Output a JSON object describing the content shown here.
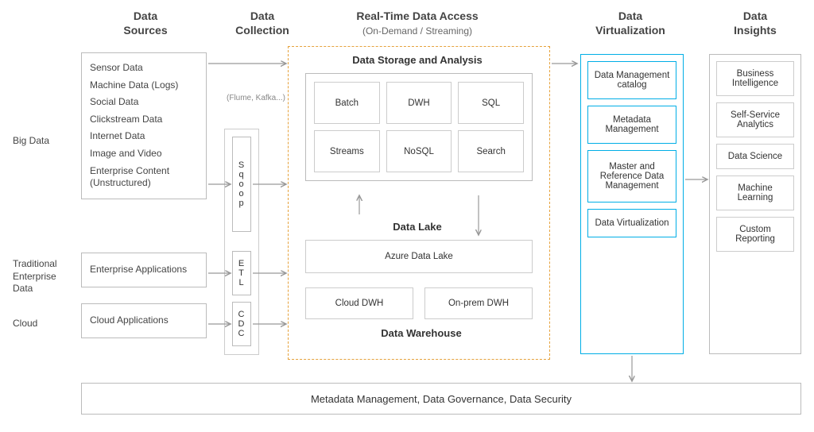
{
  "headers": {
    "sources": "Data\nSources",
    "collection": "Data\nCollection",
    "realtime": "Real-Time Data Access",
    "realtime_sub": "(On-Demand / Streaming)",
    "virtualization": "Data\nVirtualization",
    "insights": "Data\nInsights"
  },
  "row_labels": {
    "bigdata": "Big Data",
    "traditional": "Traditional Enterprise Data",
    "cloud": "Cloud"
  },
  "sources": {
    "bigdata": [
      "Sensor Data",
      "Machine Data (Logs)",
      "Social Data",
      "Clickstream Data",
      "Internet Data",
      "Image and Video",
      "Enterprise Content (Unstructured)"
    ],
    "traditional": "Enterprise Applications",
    "cloud": "Cloud Applications"
  },
  "collection": {
    "note": "(Flume, Kafka...)",
    "sqoop": "S\nq\no\no\np",
    "etl": "E\nT\nL",
    "cdc": "C\nD\nC"
  },
  "storage": {
    "title": "Data Storage and Analysis",
    "cells": [
      "Batch",
      "DWH",
      "SQL",
      "Streams",
      "NoSQL",
      "Search"
    ],
    "lake_title": "Data Lake",
    "lake": "Azure Data Lake",
    "dwh_cells": [
      "Cloud DWH",
      "On-prem DWH"
    ],
    "dw_title": "Data Warehouse"
  },
  "virtualization": [
    "Data Management catalog",
    "Metadata Management",
    "Master and Reference Data Management",
    "Data Virtualization"
  ],
  "insights": [
    "Business Intelligence",
    "Self-Service Analytics",
    "Data Science",
    "Machine Learning",
    "Custom Reporting"
  ],
  "footer": "Metadata Management, Data Governance, Data Security"
}
